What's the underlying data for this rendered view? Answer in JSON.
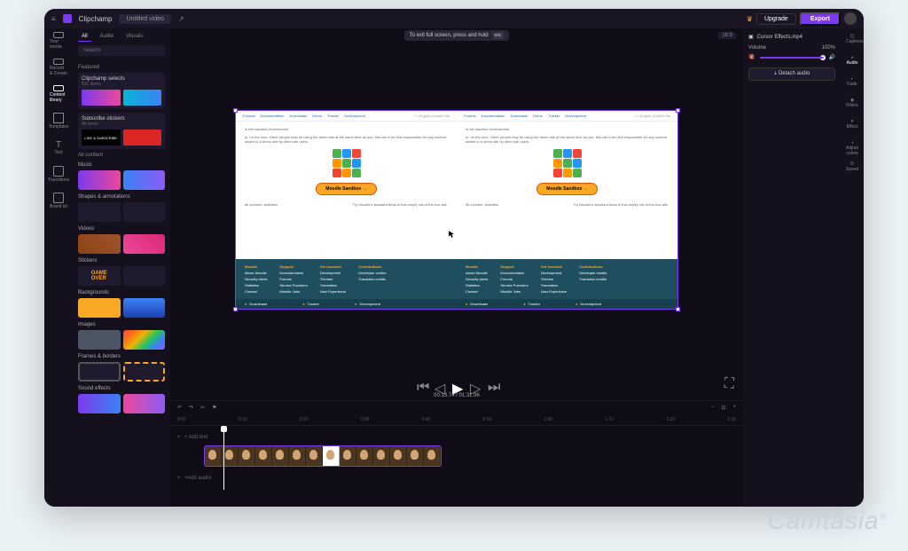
{
  "title": "Clipchamp",
  "tab": "Untitled video",
  "upgrade": "Upgrade",
  "export": "Export",
  "nav": [
    "Your media",
    "Record & Create",
    "Content library",
    "Templates",
    "Text",
    "Transitions",
    "Brand kit"
  ],
  "filters": {
    "all": "All",
    "audio": "Audio",
    "visuals": "Visuals"
  },
  "search_ph": "Search",
  "featured": "Featured",
  "cards": {
    "selects": "Clipchamp selects",
    "selects_sub": "831 items",
    "stickers": "Subscribe stickers",
    "stickers_sub": "46 items",
    "like": "LIKE & SUBSCRIBE"
  },
  "all_content": "All content",
  "cats": [
    "Music",
    "Shapes & annotations",
    "Videos",
    "Stickers",
    "Backgrounds",
    "Images",
    "Frames & borders",
    "Sound effects"
  ],
  "fullscreen": "To exit full screen, press and hold",
  "esc": "esc",
  "ratio": "16:9",
  "moodle_nav": [
    "Forums",
    "Documentation",
    "Downloads",
    "Demo",
    "Tracker",
    "Development"
  ],
  "moodle_lang": "English (United Sta",
  "sandbox_note": "in the sandbox environment.",
  "sandbox_text": "ur, on the hour. Other people may be using the demo site at the same time as you; this can it be held responsible for any content added to a demo site by other site users.",
  "sandbox_btn": "Moodle Sandbox",
  "try_text": "Try Moodle's standard featu",
  "try_text2": "in this empty out-of-the-box site.",
  "courses": "ith courses, activities",
  "footer": {
    "c1": {
      "h": "Moodle",
      "items": [
        "About Moodle",
        "Security alerts",
        "Statistics",
        "Contact"
      ]
    },
    "c2": {
      "h": "Support",
      "items": [
        "Documentation",
        "Forums",
        "Service Providers",
        "Moodle Jobs"
      ]
    },
    "c3": {
      "h": "Get Involved",
      "items": [
        "Development",
        "Themes",
        "Translation",
        "User Experience"
      ]
    },
    "c4": {
      "h": "Contributions",
      "items": [
        "Developer credits",
        "Translator credits"
      ]
    }
  },
  "footer_dl": [
    "Downloads",
    "Tracker",
    "Development"
  ],
  "time": "00:13.74 / 01:31.96",
  "ruler": [
    "0:00",
    "0:10",
    "0:20",
    "0:30",
    "0:40",
    "0:50",
    "1:00",
    "1:10",
    "1:20",
    "1:30"
  ],
  "track_add": "+ Add text",
  "track_audio": "+Add audio",
  "insp_file": "Cursor Effects.mp4",
  "volume": "Volume",
  "vol_val": "100%",
  "detach": "Detach audio",
  "tools": [
    "Captions",
    "Audio",
    "Fade",
    "Filters",
    "Effect",
    "Adjust colors",
    "Speed"
  ],
  "wm": "Camtasia"
}
